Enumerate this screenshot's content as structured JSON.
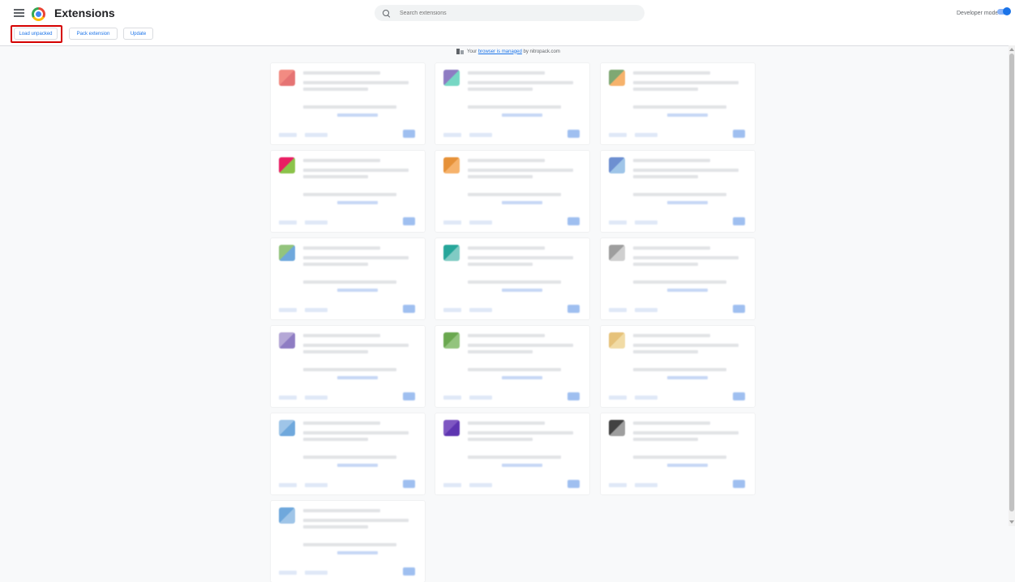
{
  "header": {
    "title": "Extensions",
    "search_placeholder": "Search extensions",
    "developer_mode_label": "Developer mode"
  },
  "actions": {
    "load_unpacked": "Load unpacked",
    "pack_extension": "Pack extension",
    "update": "Update"
  },
  "managed_notice": {
    "prefix": "Your ",
    "link": "browser is managed",
    "suffix": " by nitropack.com"
  },
  "colors": {
    "accent": "#1a73e8",
    "highlight": "#d50000"
  },
  "extension_cards": [
    {
      "icon_colors": [
        "#f28b82",
        "#e57373"
      ]
    },
    {
      "icon_colors": [
        "#8e7cc3",
        "#76d7c4"
      ]
    },
    {
      "icon_colors": [
        "#7fa873",
        "#f6b26b"
      ]
    },
    {
      "icon_colors": [
        "#e91e63",
        "#8bc34a"
      ]
    },
    {
      "icon_colors": [
        "#e69138",
        "#f6b26b"
      ]
    },
    {
      "icon_colors": [
        "#6d8fd1",
        "#9fc5e8"
      ]
    },
    {
      "icon_colors": [
        "#93c47d",
        "#6fa8dc"
      ]
    },
    {
      "icon_colors": [
        "#26a69a",
        "#80cbc4"
      ]
    },
    {
      "icon_colors": [
        "#9e9e9e",
        "#cfcfcf"
      ]
    },
    {
      "icon_colors": [
        "#b4a7d6",
        "#8e7cc3"
      ]
    },
    {
      "icon_colors": [
        "#6aa84f",
        "#93c47d"
      ]
    },
    {
      "icon_colors": [
        "#e6c27a",
        "#f1dba5"
      ]
    },
    {
      "icon_colors": [
        "#9fc5e8",
        "#6fa8dc"
      ]
    },
    {
      "icon_colors": [
        "#7e57c2",
        "#5e35b1"
      ]
    },
    {
      "icon_colors": [
        "#424242",
        "#9e9e9e"
      ]
    },
    {
      "icon_colors": [
        "#6fa8dc",
        "#9fc5e8"
      ]
    }
  ]
}
